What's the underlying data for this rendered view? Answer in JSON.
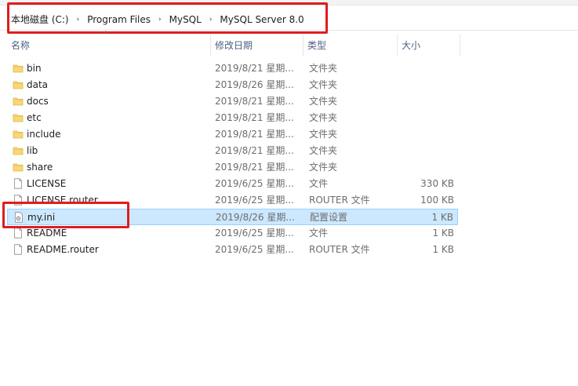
{
  "address": {
    "crumbs": [
      "本地磁盘 (C:)",
      "Program Files",
      "MySQL",
      "MySQL Server 8.0"
    ],
    "separator": "›"
  },
  "columns": {
    "name": "名称",
    "date": "修改日期",
    "type": "类型",
    "size": "大小"
  },
  "files": [
    {
      "name": "bin",
      "date": "2019/8/21 星期...",
      "type": "文件夹",
      "size": "",
      "icon": "folder-icon"
    },
    {
      "name": "data",
      "date": "2019/8/26 星期...",
      "type": "文件夹",
      "size": "",
      "icon": "folder-icon"
    },
    {
      "name": "docs",
      "date": "2019/8/21 星期...",
      "type": "文件夹",
      "size": "",
      "icon": "folder-icon"
    },
    {
      "name": "etc",
      "date": "2019/8/21 星期...",
      "type": "文件夹",
      "size": "",
      "icon": "folder-icon"
    },
    {
      "name": "include",
      "date": "2019/8/21 星期...",
      "type": "文件夹",
      "size": "",
      "icon": "folder-icon"
    },
    {
      "name": "lib",
      "date": "2019/8/21 星期...",
      "type": "文件夹",
      "size": "",
      "icon": "folder-icon"
    },
    {
      "name": "share",
      "date": "2019/8/21 星期...",
      "type": "文件夹",
      "size": "",
      "icon": "folder-icon"
    },
    {
      "name": "LICENSE",
      "date": "2019/6/25 星期...",
      "type": "文件",
      "size": "330 KB",
      "icon": "file-icon"
    },
    {
      "name": "LICENSE.router",
      "date": "2019/6/25 星期...",
      "type": "ROUTER 文件",
      "size": "100 KB",
      "icon": "file-icon"
    },
    {
      "name": "my.ini",
      "date": "2019/8/26 星期...",
      "type": "配置设置",
      "size": "1 KB",
      "icon": "config-file-icon",
      "selected": true
    },
    {
      "name": "README",
      "date": "2019/6/25 星期...",
      "type": "文件",
      "size": "1 KB",
      "icon": "file-icon"
    },
    {
      "name": "README.router",
      "date": "2019/6/25 星期...",
      "type": "ROUTER 文件",
      "size": "1 KB",
      "icon": "file-icon"
    }
  ],
  "colors": {
    "highlight": "#e01d1d",
    "selection": "#cce8ff",
    "folder": "#f8d775"
  }
}
